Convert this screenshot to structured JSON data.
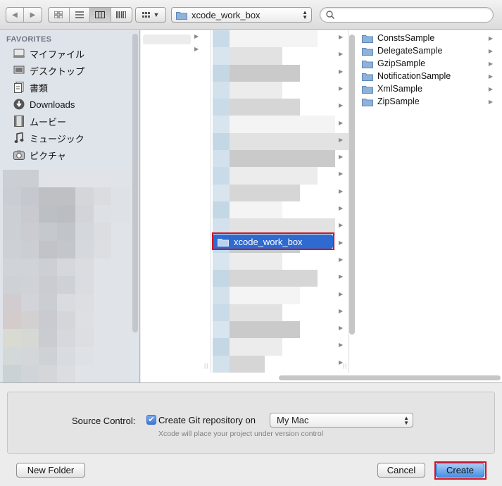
{
  "toolbar": {
    "back_icon": "chevron-left-icon",
    "forward_icon": "chevron-right-icon",
    "views": [
      {
        "name": "icon-view-icon",
        "glyph": "⊞",
        "active": false
      },
      {
        "name": "list-view-icon",
        "glyph": "☰",
        "active": false
      },
      {
        "name": "column-view-icon",
        "glyph": "▥",
        "active": true
      },
      {
        "name": "coverflow-view-icon",
        "glyph": "▦",
        "active": false
      }
    ],
    "arrange_glyph": "⊞",
    "path_label": "xcode_work_box",
    "search_placeholder": ""
  },
  "sidebar": {
    "heading": "FAVORITES",
    "items": [
      {
        "label": "マイファイル",
        "icon": "all-my-files-icon",
        "glyph": "▤"
      },
      {
        "label": "デスクトップ",
        "icon": "desktop-icon",
        "glyph": "▭"
      },
      {
        "label": "書類",
        "icon": "documents-icon",
        "glyph": "🗎"
      },
      {
        "label": "Downloads",
        "icon": "downloads-icon",
        "glyph": "⬇"
      },
      {
        "label": "ムービー",
        "icon": "movies-icon",
        "glyph": "▦"
      },
      {
        "label": "ミュージック",
        "icon": "music-icon",
        "glyph": "♫"
      },
      {
        "label": "ピクチャ",
        "icon": "pictures-icon",
        "glyph": "◉"
      }
    ]
  },
  "columns": {
    "selected_folder": "xcode_work_box",
    "folders": [
      "ConstsSample",
      "DelegateSample",
      "GzipSample",
      "NotificationSample",
      "XmlSample",
      "ZipSample"
    ]
  },
  "options": {
    "source_control_label": "Source Control:",
    "create_git_label": "Create Git repository on",
    "git_checked": true,
    "location_value": "My Mac",
    "hint": "Xcode will place your project under version control"
  },
  "buttons": {
    "new_folder": "New Folder",
    "cancel": "Cancel",
    "create": "Create"
  },
  "colors": {
    "selection": "#2e6ad0",
    "highlight_border": "#d0152a",
    "default_button": "#4a90e2"
  }
}
